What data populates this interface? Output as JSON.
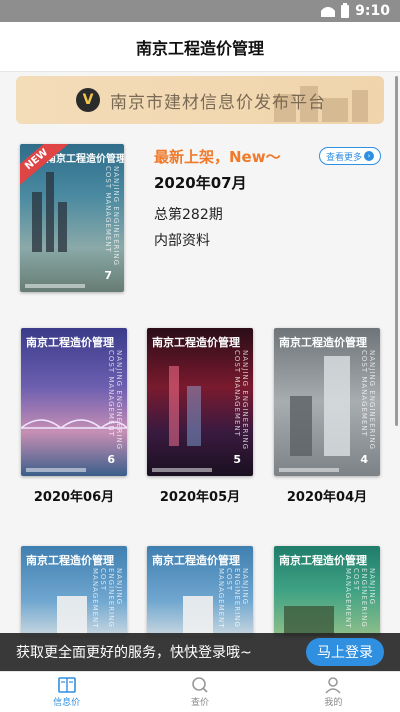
{
  "status_bar": {
    "time": "9:10"
  },
  "header": {
    "title": "南京工程造价管理"
  },
  "banner": {
    "badge": "V",
    "text": "南京市建材信息价发布平台"
  },
  "featured": {
    "ribbon": "NEW",
    "headline": "最新上架，New～",
    "more_label": "查看更多",
    "issue_date": "2020年07月",
    "issue_number": "总第282期",
    "internal": "内部资料",
    "cover_title": "南京工程造价管理",
    "cover_issue": "7"
  },
  "issues": [
    {
      "caption": "2020年06月",
      "cover_title": "南京工程造价管理",
      "issue": "6"
    },
    {
      "caption": "2020年05月",
      "cover_title": "南京工程造价管理",
      "issue": "5"
    },
    {
      "caption": "2020年04月",
      "cover_title": "南京工程造价管理",
      "issue": "4"
    },
    {
      "caption": "",
      "cover_title": "南京工程造价管理",
      "issue": ""
    },
    {
      "caption": "",
      "cover_title": "南京工程造价管理",
      "issue": ""
    },
    {
      "caption": "",
      "cover_title": "南京工程造价管理",
      "issue": ""
    }
  ],
  "cover_vertical_text": "NANJING ENGINEERING COST MANAGEMENT",
  "login_bar": {
    "text": "获取更全面更好的服务，快快登录哦~",
    "button": "马上登录"
  },
  "bottom_nav": [
    {
      "label": "信息价",
      "icon": "book-icon",
      "active": true
    },
    {
      "label": "查价",
      "icon": "search-icon",
      "active": false
    },
    {
      "label": "我的",
      "icon": "user-icon",
      "active": false
    }
  ],
  "colors": {
    "accent": "#2f8fe0",
    "headline": "#f07a2b",
    "banner": "#f3dcb8"
  }
}
